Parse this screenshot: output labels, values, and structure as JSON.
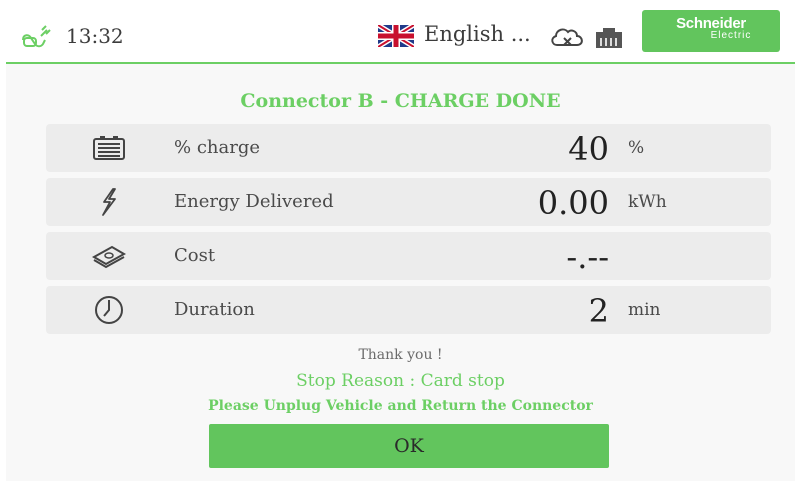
{
  "header": {
    "time": "13:32",
    "language": "English ...",
    "logo_main": "Schneider",
    "logo_sub": "Electric",
    "icons": [
      "plug-icon",
      "uk-flag-icon",
      "cloud-disconnected-icon",
      "network-icon"
    ]
  },
  "title": "Connector B - CHARGE DONE",
  "rows": [
    {
      "icon": "battery-icon",
      "label": "% charge",
      "value": "40",
      "unit": "%"
    },
    {
      "icon": "lightning-icon",
      "label": "Energy Delivered",
      "value": "0.00",
      "unit": "kWh"
    },
    {
      "icon": "money-icon",
      "label": "Cost",
      "value": "-.--",
      "unit": ""
    },
    {
      "icon": "timer-icon",
      "label": "Duration",
      "value": "2",
      "unit": "min"
    }
  ],
  "messages": {
    "thanks": "Thank you !",
    "stop_reason": "Stop Reason : Card stop",
    "unplug": "Please Unplug Vehicle and Return the Connector"
  },
  "ok_label": "OK",
  "colors": {
    "accent": "#6ccf64",
    "button": "#62c55d",
    "row_bg": "#ececec"
  }
}
